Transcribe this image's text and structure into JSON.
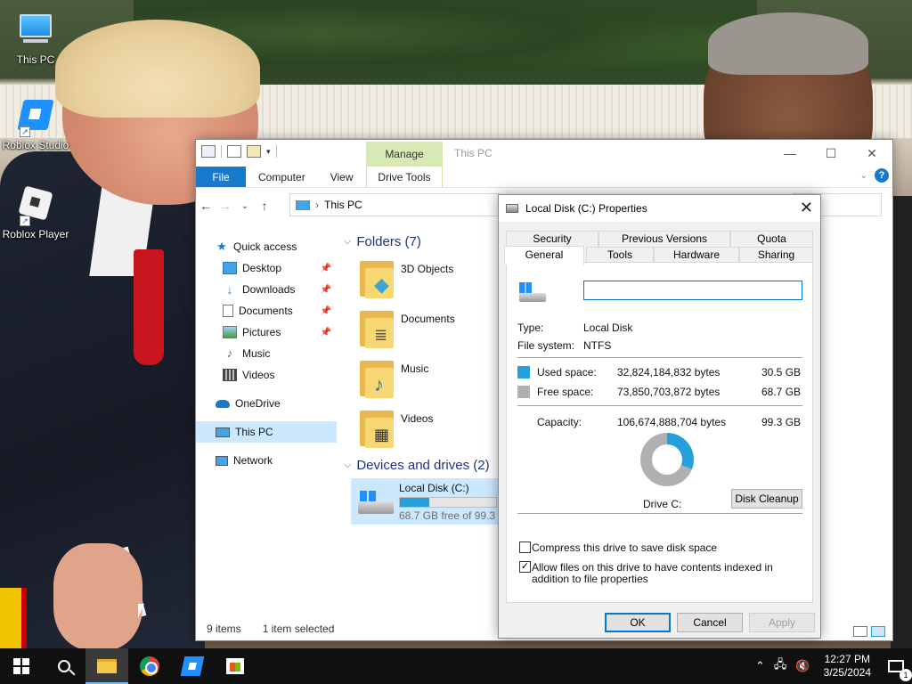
{
  "desktop": {
    "icons": [
      {
        "label": "This PC",
        "icon": "this-pc-icon"
      },
      {
        "label": "Roblox Studio",
        "icon": "roblox-studio-icon"
      },
      {
        "label": "Roblox Player",
        "icon": "roblox-player-icon"
      }
    ]
  },
  "explorer": {
    "title": "This PC",
    "manage_tab": "Manage",
    "ribbon_tabs": {
      "file": "File",
      "computer": "Computer",
      "view": "View",
      "drive_tools": "Drive Tools"
    },
    "controls": {
      "minimize": "—",
      "maximize": "☐",
      "close": "✕"
    },
    "address": "This PC",
    "nav": {
      "quick_access": "Quick access",
      "desktop": "Desktop",
      "downloads": "Downloads",
      "documents": "Documents",
      "pictures": "Pictures",
      "music": "Music",
      "videos": "Videos",
      "onedrive": "OneDrive",
      "this_pc": "This PC",
      "network": "Network"
    },
    "folders_header": "Folders (7)",
    "folders": [
      "3D Objects",
      "Documents",
      "Music",
      "Videos"
    ],
    "devices_header": "Devices and drives (2)",
    "drive": {
      "name": "Local Disk (C:)",
      "free_text": "68.7 GB free of 99.3 GB",
      "used_fraction": 0.307
    },
    "status": {
      "items": "9 items",
      "selected": "1 item selected"
    }
  },
  "props": {
    "title": "Local Disk (C:) Properties",
    "tabs_top": [
      "Security",
      "Previous Versions",
      "Quota"
    ],
    "tabs_bottom": [
      "General",
      "Tools",
      "Hardware",
      "Sharing"
    ],
    "label_value": "",
    "type_label": "Type:",
    "type_value": "Local Disk",
    "fs_label": "File system:",
    "fs_value": "NTFS",
    "used_label": "Used space:",
    "used_bytes": "32,824,184,832 bytes",
    "used_gb": "30.5 GB",
    "free_label": "Free space:",
    "free_bytes": "73,850,703,872 bytes",
    "free_gb": "68.7 GB",
    "cap_label": "Capacity:",
    "cap_bytes": "106,674,888,704 bytes",
    "cap_gb": "99.3 GB",
    "drive_label": "Drive C:",
    "disk_cleanup": "Disk Cleanup",
    "compress_label": "Compress this drive to save disk space",
    "compress_checked": false,
    "index_label": "Allow files on this drive to have contents indexed in addition to file properties",
    "index_checked": true,
    "ok": "OK",
    "cancel": "Cancel",
    "apply": "Apply",
    "used_color": "#26a0da",
    "free_color": "#b0b0b0",
    "used_fraction": 0.307
  },
  "taskbar": {
    "time": "12:27 PM",
    "date": "3/25/2024",
    "notification_count": "1",
    "tray_up": "⌃"
  }
}
